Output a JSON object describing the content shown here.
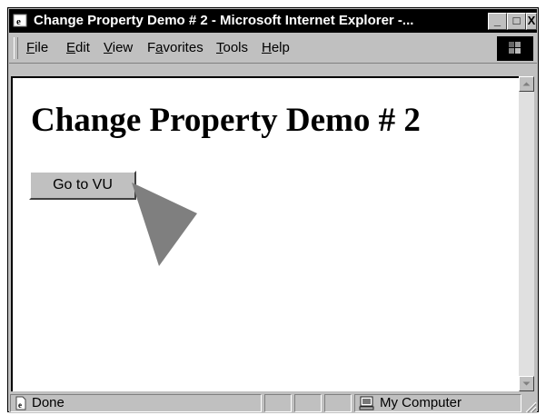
{
  "window": {
    "title": "Change Property Demo # 2 - Microsoft Internet Explorer -...",
    "minimize_label": "_",
    "maximize_label": "□",
    "close_label": "X"
  },
  "menubar": {
    "items": [
      {
        "prefix": "",
        "mnemonic": "F",
        "rest": "ile"
      },
      {
        "prefix": "",
        "mnemonic": "E",
        "rest": "dit"
      },
      {
        "prefix": "",
        "mnemonic": "V",
        "rest": "iew"
      },
      {
        "prefix": "F",
        "mnemonic": "a",
        "rest": "vorites"
      },
      {
        "prefix": "",
        "mnemonic": "T",
        "rest": "ools"
      },
      {
        "prefix": "",
        "mnemonic": "H",
        "rest": "elp"
      }
    ]
  },
  "page": {
    "heading": "Change Property Demo # 2",
    "button_label": "Go to VU"
  },
  "status": {
    "text": "Done",
    "zone": "My Computer"
  },
  "icons": [
    "ie-app-icon",
    "windows-logo-icon",
    "page-done-icon",
    "computer-icon",
    "cursor-arrow-icon",
    "resize-grip-icon"
  ],
  "colors": {
    "titlebar": "#000000",
    "chrome": "#c0c0c0",
    "page_background": "#ffffff",
    "cursor": "#7f7f7f"
  }
}
